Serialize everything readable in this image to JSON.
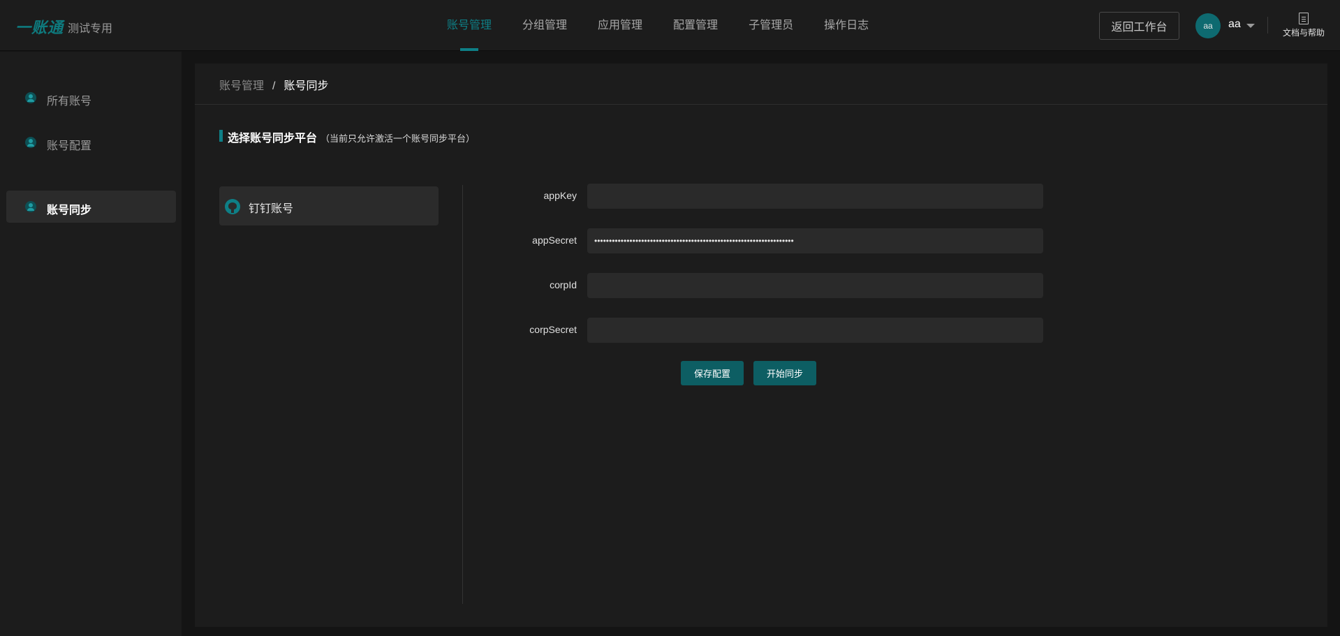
{
  "header": {
    "logo": "一账通",
    "logo_sub": "测试专用",
    "nav": [
      "账号管理",
      "分组管理",
      "应用管理",
      "配置管理",
      "子管理员",
      "操作日志"
    ],
    "workbench_button": "返回工作台",
    "avatar_initials": "aa",
    "username": "aa",
    "help_label": "文档与帮助"
  },
  "sidebar": {
    "items": [
      {
        "label": "所有账号",
        "icon": "user-icon"
      },
      {
        "label": "账号配置",
        "icon": "user-settings-icon"
      },
      {
        "label": "账号同步",
        "icon": "sync-icon"
      }
    ]
  },
  "breadcrumb": {
    "parent": "账号管理",
    "separator": "/",
    "current": "账号同步"
  },
  "section": {
    "title": "选择账号同步平台",
    "note": "（当前只允许激活一个账号同步平台）"
  },
  "platform": {
    "label": "钉钉账号",
    "icon": "github-icon"
  },
  "form": {
    "app_key": {
      "label": "appKey",
      "value": ""
    },
    "app_secret": {
      "label": "appSecret",
      "value": "••••••••••••••••••••••••••••••••••••••••••••••••••••••••••••••••••••"
    },
    "corp_id": {
      "label": "corpId",
      "value": ""
    },
    "corp_secret": {
      "label": "corpSecret",
      "value": ""
    }
  },
  "actions": {
    "save": "保存配置",
    "sync": "开始同步"
  },
  "colors": {
    "accent": "#0e7f86",
    "button": "#0d5e63",
    "background": "#141414",
    "panel": "#1c1c1c"
  }
}
